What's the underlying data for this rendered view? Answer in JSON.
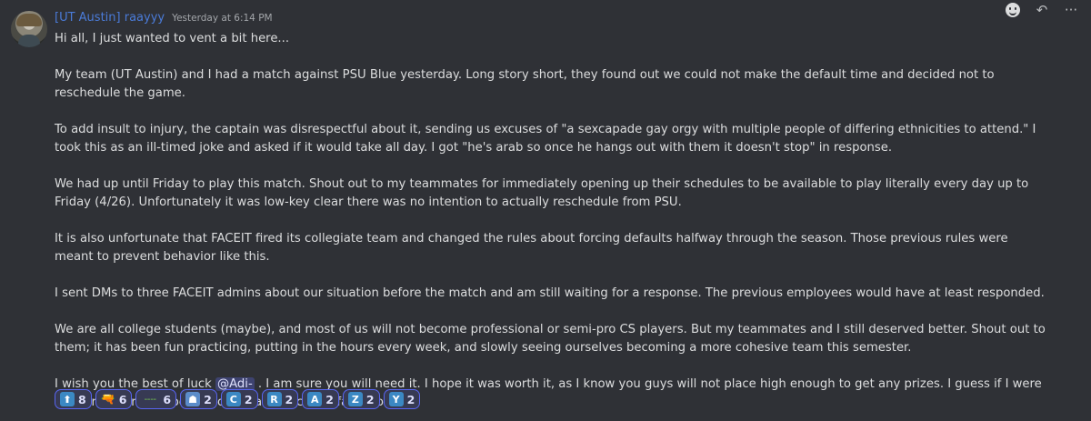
{
  "message": {
    "author": "[UT Austin] raayyy",
    "timestamp": "Yesterday at 6:14 PM",
    "paragraphs": [
      "Hi all, I just wanted to vent a bit here...",
      "My team (UT Austin) and I had a match against PSU Blue yesterday. Long story short, they found out we could not make the default time and decided not to reschedule the game.",
      "To add insult to injury, the captain was disrespectful about it, sending us excuses of \"a sexcapade gay orgy with multiple people of differing ethnicities to attend.\" I took this as an ill-timed joke and asked if it would take all day. I got \"he's arab so once he hangs out with them it doesn't stop\" in response.",
      "We had up until Friday to play this match. Shout out to my teammates for immediately opening up their schedules to be available to play literally every day up to Friday (4/26). Unfortunately it was low-key clear there was no intention to actually reschedule from PSU.",
      "It is also unfortunate that FACEIT fired its collegiate team and changed the rules about forcing defaults halfway through the season. Those previous rules were meant to prevent behavior like this.",
      "I sent DMs to three FACEIT admins about our situation before the match and am still waiting for a response. The previous employees would have at least responded.",
      "We are all college students (maybe), and most of us will not become professional or semi-pro CS players. But my teammates and I still deserved better. Shout out to them; it has been fun practicing, putting in the hours every week, and slowly seeing ourselves becoming a more cohesive team this semester."
    ],
    "last_paragraph": {
      "before": "I wish you the best of luck ",
      "mention": "@Adi-",
      "after": " . I am sure you will need it. I hope it was worth it, as I know you guys will not place high enough to get any prizes. I guess if I were in your cowardly shoes, I would have forced default, too."
    }
  },
  "toolbar": {
    "icons": [
      "add-reaction-icon",
      "reply-icon",
      "more-icon"
    ],
    "reply_glyph": "↶",
    "more_glyph": "···"
  },
  "reactions": [
    {
      "icon": "arrow-up-icon",
      "glyph": "⬆",
      "count": "8"
    },
    {
      "icon": "gun-icon",
      "glyph": "🔫",
      "count": "6"
    },
    {
      "icon": "dash-icon",
      "glyph": "╌╌",
      "count": "6"
    },
    {
      "icon": "person-icon",
      "glyph": "☗",
      "count": "2"
    },
    {
      "icon": "letter-c-icon",
      "glyph": "C",
      "count": "2"
    },
    {
      "icon": "letter-r-icon",
      "glyph": "R",
      "count": "2"
    },
    {
      "icon": "letter-a-icon",
      "glyph": "A",
      "count": "2"
    },
    {
      "icon": "letter-z-icon",
      "glyph": "Z",
      "count": "2"
    },
    {
      "icon": "letter-y-icon",
      "glyph": "Y",
      "count": "2"
    }
  ],
  "colors": {
    "background": "#2f3136",
    "author": "#4a7bd8",
    "mention_bg": "#3e4370",
    "reaction_border": "#5865f2",
    "letter_icon": "#3b88c3"
  }
}
